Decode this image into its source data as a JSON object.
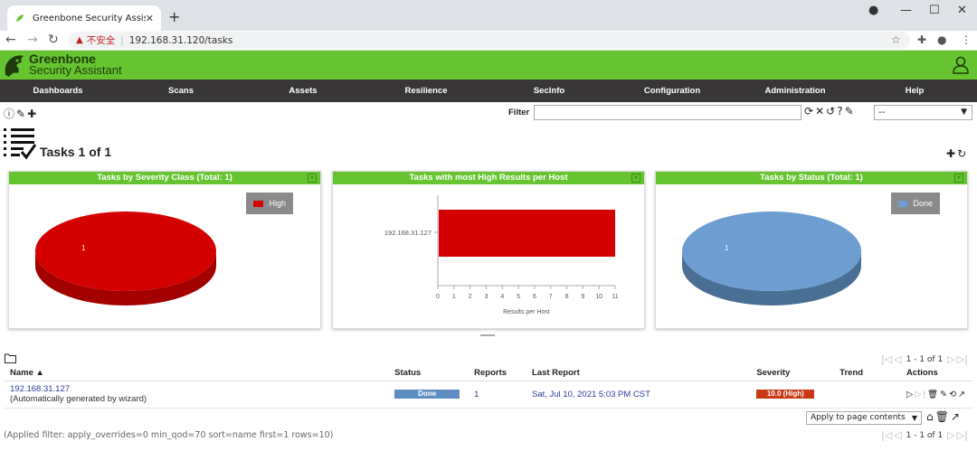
{
  "browser": {
    "tab_title": "Greenbone Security Assistant",
    "tab_close": "✕",
    "new_tab": "+",
    "insecure_label": "不安全",
    "url": "192.168.31.120/tasks"
  },
  "header": {
    "brand_line1": "Greenbone",
    "brand_line2": "Security Assistant"
  },
  "menu": [
    "Dashboards",
    "Scans",
    "Assets",
    "Resilience",
    "SecInfo",
    "Configuration",
    "Administration",
    "Help"
  ],
  "filter": {
    "label": "Filter",
    "value": "",
    "selected": "--"
  },
  "page": {
    "title": "Tasks 1 of 1"
  },
  "panels": [
    {
      "title": "Tasks by Severity Class (Total: 1)",
      "legend": "High",
      "legend_color": "#d40000",
      "slice_label": "1"
    },
    {
      "title": "Tasks with most High Results per Host",
      "host": "192.168.31.127",
      "xlabel": "Results per Host",
      "ticks": [
        "0",
        "1",
        "2",
        "3",
        "4",
        "5",
        "6",
        "7",
        "8",
        "9",
        "10",
        "11"
      ]
    },
    {
      "title": "Tasks by Status (Total: 1)",
      "legend": "Done",
      "legend_color": "#6d9dd1",
      "slice_label": "1"
    }
  ],
  "chart_data": [
    {
      "type": "pie",
      "title": "Tasks by Severity Class (Total: 1)",
      "categories": [
        "High"
      ],
      "values": [
        1
      ],
      "colors": [
        "#d40000"
      ]
    },
    {
      "type": "bar",
      "title": "Tasks with most High Results per Host",
      "categories": [
        "192.168.31.127"
      ],
      "values": [
        11
      ],
      "xlabel": "Results per Host",
      "xlim": [
        0,
        11
      ],
      "orientation": "horizontal",
      "color": "#d40000"
    },
    {
      "type": "pie",
      "title": "Tasks by Status (Total: 1)",
      "categories": [
        "Done"
      ],
      "values": [
        1
      ],
      "colors": [
        "#6d9dd1"
      ]
    }
  ],
  "pagination": {
    "text": "1 - 1 of 1"
  },
  "table": {
    "headers": {
      "name": "Name ▲",
      "status": "Status",
      "reports": "Reports",
      "last_report": "Last Report",
      "severity": "Severity",
      "trend": "Trend",
      "actions": "Actions"
    },
    "rows": [
      {
        "name": "192.168.31.127",
        "comment": "(Automatically generated by wizard)",
        "status": "Done",
        "reports": "1",
        "last_report": "Sat, Jul 10, 2021 5:03 PM CST",
        "severity": "10.0 (High)",
        "trend": ""
      }
    ]
  },
  "bulk": {
    "selected": "Apply to page contents"
  },
  "applied_filter": "(Applied filter: apply_overrides=0 min_qod=70 sort=name first=1 rows=10)"
}
